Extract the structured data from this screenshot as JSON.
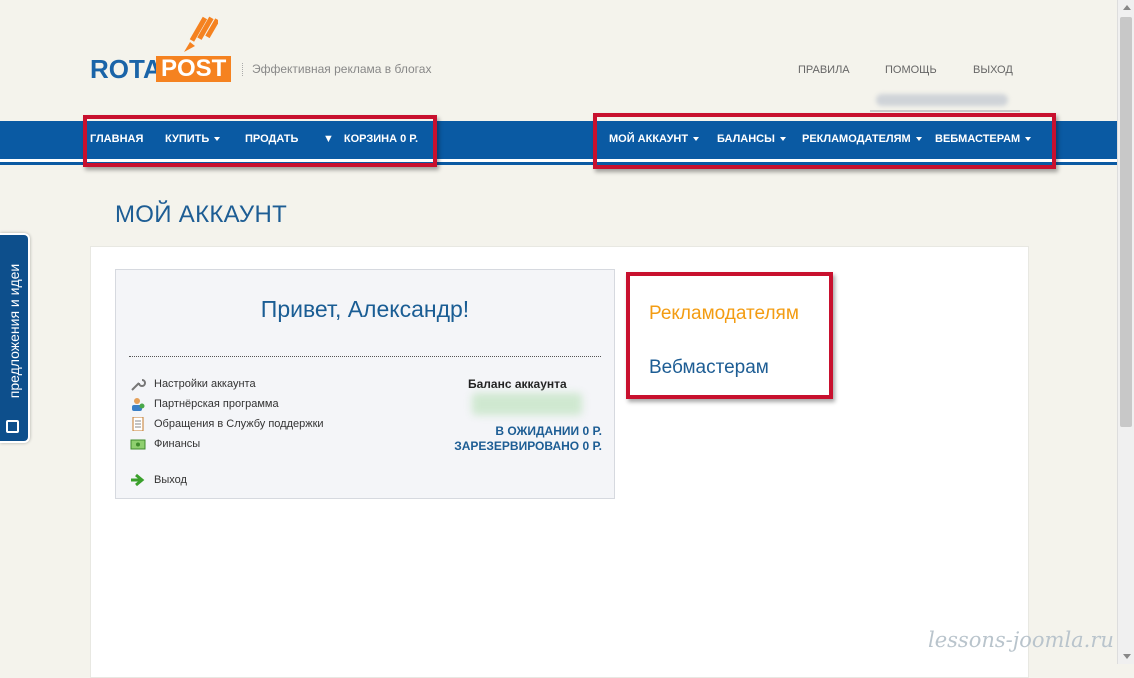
{
  "header": {
    "logo_rota": "ROTA",
    "logo_post": "POST",
    "tagline": "Эффективная реклама в блогах",
    "links": [
      "ПРАВИЛА",
      "ПОМОЩЬ",
      "ВЫХОД"
    ]
  },
  "nav": {
    "left": [
      {
        "label": "ГЛАВНАЯ"
      },
      {
        "label": "КУПИТЬ"
      },
      {
        "label": "ПРОДАТЬ"
      },
      {
        "label": "КОРЗИНА 0 Р."
      }
    ],
    "right": [
      {
        "label": "МОЙ АККАУНТ"
      },
      {
        "label": "БАЛАНСЫ"
      },
      {
        "label": "РЕКЛАМОДАТЕЛЯМ"
      },
      {
        "label": "ВЕБМАСТЕРАМ"
      }
    ]
  },
  "page": {
    "title": "МОЙ АККАУНТ"
  },
  "account": {
    "greeting": "Привет, Александр!",
    "menu": [
      {
        "label": "Настройки аккаунта",
        "icon": "wrench-icon"
      },
      {
        "label": "Партнёрская программа",
        "icon": "users-icon"
      },
      {
        "label": "Обращения в Службу поддержки",
        "icon": "document-icon"
      },
      {
        "label": "Финансы",
        "icon": "money-icon"
      },
      {
        "label": "Выход",
        "icon": "arrow-right-icon"
      }
    ],
    "balance_title": "Баланс аккаунта",
    "pending": "В ОЖИДАНИИ 0 р.",
    "reserved": "ЗАРЕЗЕРВИРОВАНО 0 р."
  },
  "side_links": {
    "advertisers": "Рекламодателям",
    "webmasters": "Вебмастерам"
  },
  "feedback_tab": "предложения и идеи",
  "watermark": "lessons-joomla.ru",
  "colors": {
    "brand_blue": "#0a5aa3",
    "brand_orange": "#f58220",
    "highlight_red": "#c8102e",
    "title_blue": "#1d5d94"
  }
}
